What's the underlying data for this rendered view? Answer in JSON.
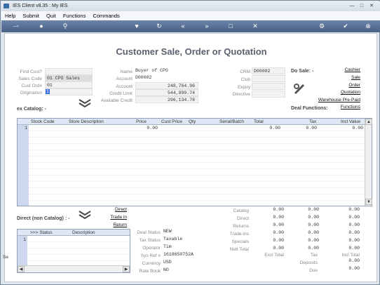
{
  "window": {
    "title": "IES Client v8.35 : My IES"
  },
  "menu": [
    "Help",
    "Submit",
    "Quit",
    "Functions",
    "Commands"
  ],
  "page_title": "Customer Sale, Order or Quotation",
  "left_fields": {
    "find_cust_label": "Find Cust?",
    "sales_code_label": "Sales Code",
    "sales_code_value": "01 CPO Sales",
    "cust_ord_label": "Cust Ord#",
    "cust_ord_value": "01",
    "origination_label": "Origination",
    "origination_value": "1"
  },
  "customer": {
    "name_label": "Name",
    "name_value": "Buyer of CPO",
    "account_label": "Account",
    "account_value": "D00002",
    "account_bal_label": "Account",
    "account_bal_value": "248,764.96",
    "credit_limit_label": "Credit Limit",
    "credit_limit_value": "544,899.74",
    "available_label": "Available Credit",
    "available_value": "296,134.78"
  },
  "crm": {
    "crm_label": "CRM",
    "crm_value": "D00002",
    "club_label": "Club",
    "expiry_label": "Expiry",
    "directive_label": "Directive"
  },
  "do_sale": {
    "label": "Do Sale: -",
    "links": [
      "Cashier",
      "Sale",
      "Order",
      "Quotation",
      "Warehouse Pre-Paid",
      "Functions"
    ]
  },
  "deal_functions_label": "Deal Functions:",
  "ex_catalog_label": "ex Catalog: -",
  "catalog_grid": {
    "columns": [
      "Stock Code",
      "Store Description",
      "Price",
      "Cust Price",
      "Qty",
      "Serial/Batch",
      "Total",
      "Tax",
      "Incl Value"
    ],
    "row": {
      "num": "1",
      "price": "0.00",
      "total": "0.00",
      "tax": "0.00",
      "incl": "0.00"
    }
  },
  "direct": {
    "label": "Direct (non Catalog) : -",
    "links": [
      "Direct",
      "Trade in",
      "Return"
    ],
    "columns": [
      ">>> Status",
      "Description"
    ],
    "row_num": "1"
  },
  "deal": {
    "deal_status_label": "Deal Status",
    "deal_status_value": "NEW",
    "tax_status_label": "Tax Status",
    "tax_status_value": "Taxable",
    "operator_label": "Operator",
    "operator_value": "Tim",
    "sys_ref_label": "Sys Ref #",
    "sys_ref_value": "1618650752A",
    "currency_label": "Currency",
    "currency_value": "USD",
    "rate_book_label": "Rate Book",
    "rate_book_value": "NO"
  },
  "totals": {
    "rows": [
      {
        "label": "Catalog",
        "a": "0.00",
        "b": "0.00",
        "c": "0.00"
      },
      {
        "label": "Direct",
        "a": "0.00",
        "b": "0.00",
        "c": "0.00"
      },
      {
        "label": "Returns",
        "a": "0.00",
        "b": "0.00",
        "c": "0.00"
      },
      {
        "label": "Trade-ins",
        "a": "0.00",
        "b": "0.00",
        "c": "0.00"
      },
      {
        "label": "Specials",
        "a": "0.00",
        "b": "0.00",
        "c": "0.00"
      },
      {
        "label": "Nett Total",
        "a": "0.00",
        "b": "0.00",
        "c": "0.00"
      }
    ],
    "excl_total_label": "Excl Total",
    "tax_label": "Tax",
    "incl_total_label": "Incl Total",
    "deposits_label": "Deposits",
    "deposits_value": "0.00",
    "due_label": "Due",
    "due_value": "0.00"
  },
  "side_stub": "Se"
}
